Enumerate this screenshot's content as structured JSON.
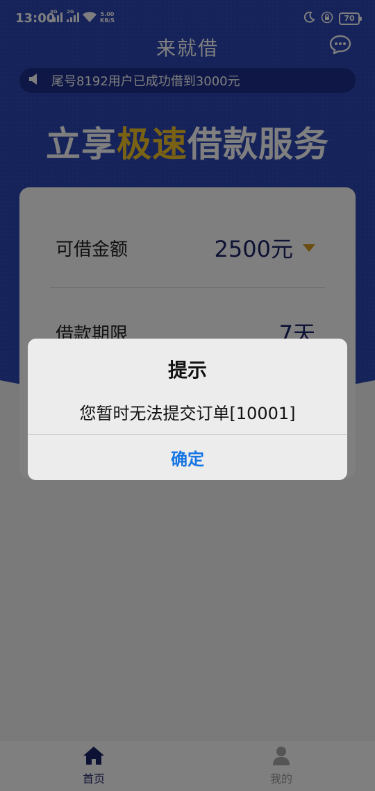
{
  "status_bar": {
    "time": "13:00",
    "network_1": "4G",
    "network_2": "2G",
    "speed_value": "5.00",
    "speed_unit": "KB/S",
    "battery": "70"
  },
  "header": {
    "title": "来就借"
  },
  "notice": {
    "text": "尾号8192用户已成功借到3000元"
  },
  "slogan": {
    "part1": "立享",
    "part2": "极速",
    "part3": "借款服务"
  },
  "loan_card": {
    "amount_label": "可借金额",
    "amount_value": "2500元",
    "term_label": "借款期限",
    "term_value": "7天"
  },
  "dialog": {
    "title": "提示",
    "message": "您暂时无法提交订单[10001]",
    "confirm_label": "确定"
  },
  "tabbar": {
    "home_label": "首页",
    "mine_label": "我的"
  },
  "colors": {
    "brand_blue": "#2c46b4",
    "slogan_highlight": "#f5c42a",
    "dialog_button": "#1474e3"
  }
}
